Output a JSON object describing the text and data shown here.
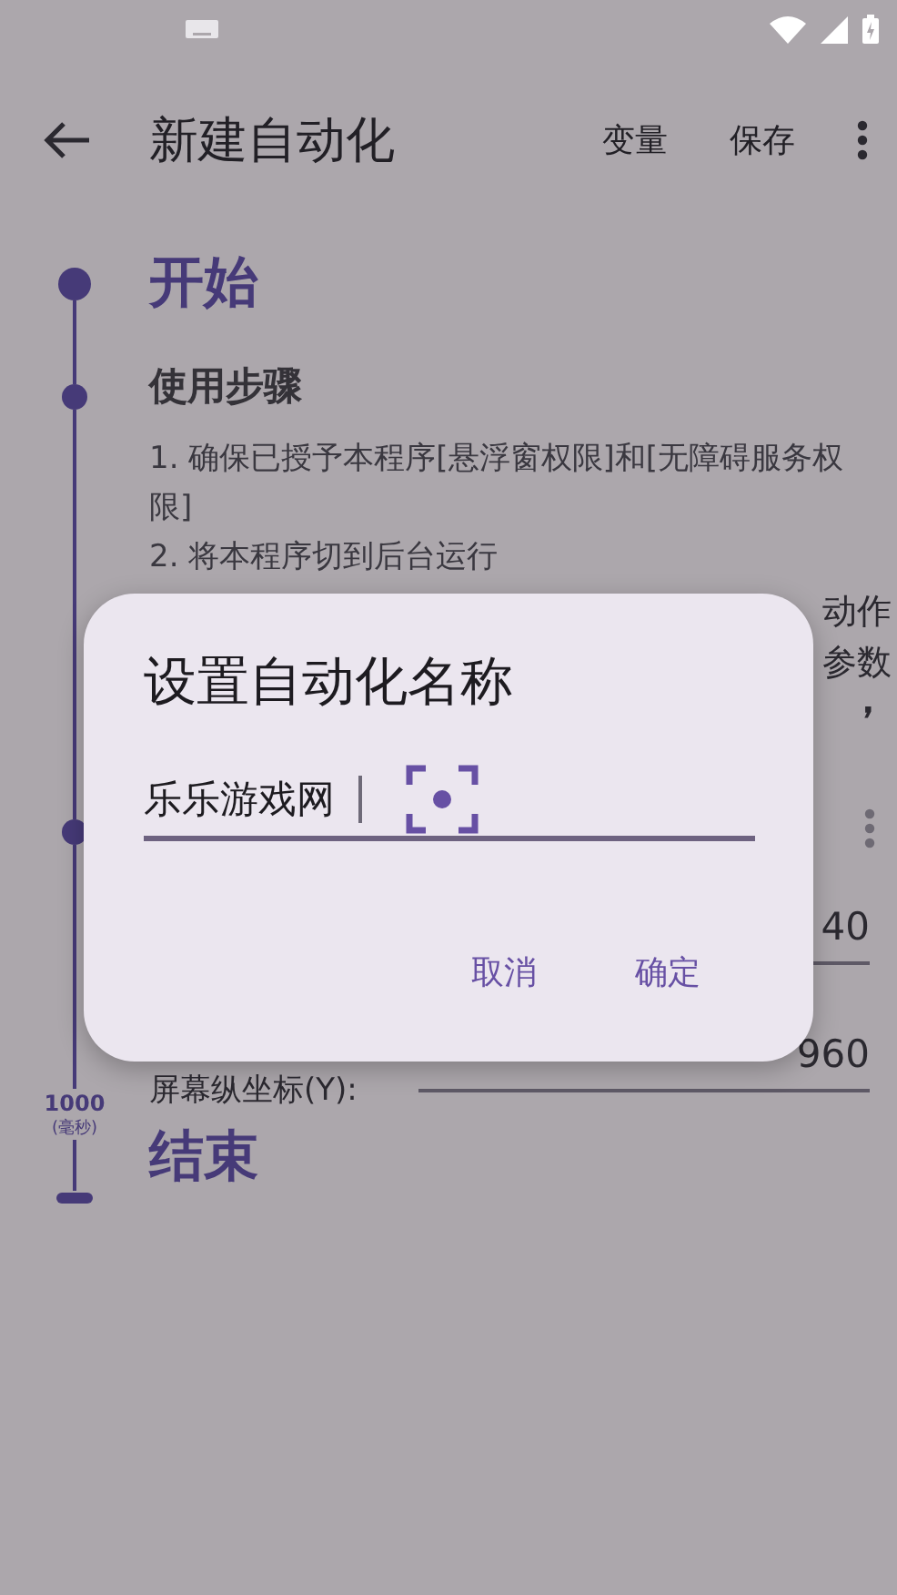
{
  "app_bar": {
    "title": "新建自动化",
    "actions": [
      "变量",
      "保存"
    ]
  },
  "timeline": {
    "start": "开始",
    "steps_title": "使用步骤",
    "steps_text": "1. 确保已授予本程序[悬浮窗权限]和[无障碍服务权限]\n2. 将本程序切到后台运行",
    "fragments": [
      "动作",
      "参数",
      "，"
    ],
    "fields": [
      {
        "value": "40"
      },
      {
        "label": "屏幕纵坐标(Y):",
        "value": "960"
      }
    ],
    "delay": {
      "value": "1000",
      "unit": "(毫秒)"
    },
    "end": "结束"
  },
  "dialog": {
    "title": "设置自动化名称",
    "input": {
      "value": "乐乐游戏网"
    },
    "buttons": [
      "取消",
      "确定"
    ]
  }
}
